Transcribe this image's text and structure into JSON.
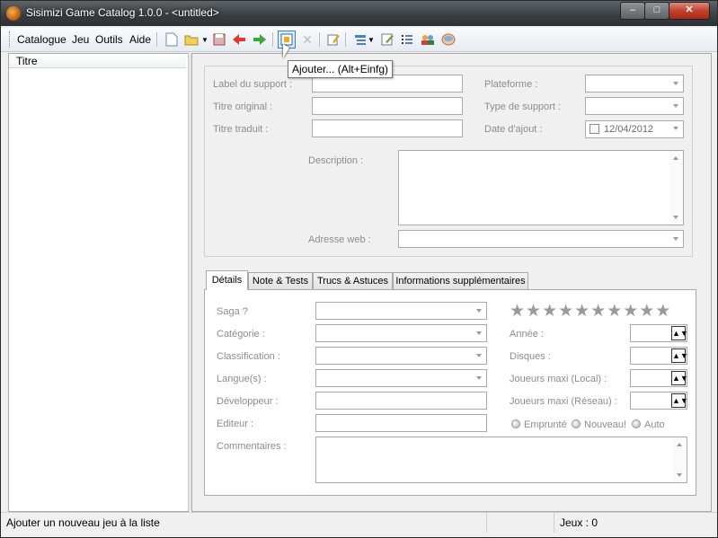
{
  "window": {
    "title": "Sisimizi Game Catalog 1.0.0 - <untitled>",
    "minimize": "–",
    "maximize": "□",
    "close": "✕"
  },
  "menu": [
    "Catalogue",
    "Jeu",
    "Outils",
    "Aide"
  ],
  "toolbar": {
    "icons": [
      "new-icon",
      "open-icon",
      "save-icon",
      "back-icon",
      "forward-icon",
      "add-icon",
      "delete-icon",
      "edit-icon",
      "list-view-icon",
      "notes-icon",
      "numbered-list-icon",
      "users-icon",
      "db-icon"
    ],
    "tooltip": "Ajouter... (Alt+Einfg)"
  },
  "list": {
    "column": "Titre"
  },
  "form": {
    "label_support": "Label du support :",
    "titre_original": "Titre original :",
    "titre_traduit": "Titre traduit :",
    "plateforme": "Plateforme :",
    "type_support": "Type de support :",
    "date_ajout": "Date d'ajout :",
    "date_value": "12/04/2012",
    "description": "Description :",
    "adresse_web": "Adresse web :"
  },
  "tabs": [
    "Détails",
    "Note & Tests",
    "Trucs & Astuces",
    "Informations supplémentaires"
  ],
  "details": {
    "saga": "Saga ?",
    "categorie": "Catégorie :",
    "classification": "Classification :",
    "langues": "Langue(s) :",
    "developpeur": "Développeur :",
    "editeur": "Editeur :",
    "commentaires": "Commentaires :",
    "annee": "Année :",
    "disques": "Disques :",
    "joueurs_local": "Joueurs maxi (Local) :",
    "joueurs_reseau": "Joueurs maxi (Réseau) :",
    "stars": "★★★★★★★★★★",
    "rating": 0,
    "rating_max": 10,
    "radio": [
      "Emprunté",
      "Nouveau!",
      "Auto"
    ]
  },
  "status": {
    "message": "Ajouter un nouveau jeu à la liste",
    "count": "Jeux : 0"
  },
  "colors": {
    "accent": "#3c7fb1",
    "label": "#8c8c8c"
  }
}
